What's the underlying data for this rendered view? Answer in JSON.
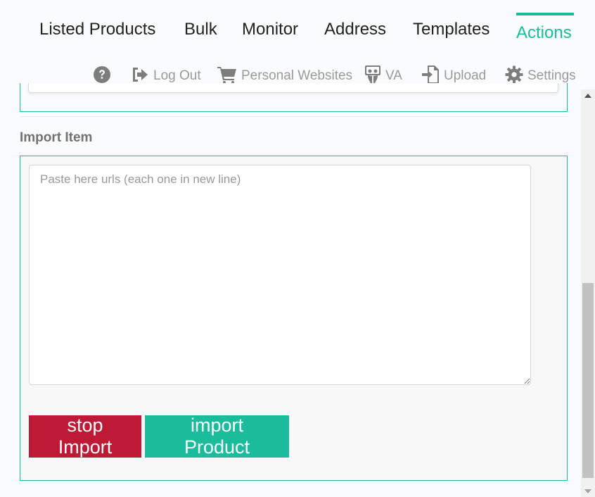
{
  "tabs": [
    {
      "label": "Listed Products"
    },
    {
      "label": "Bulk"
    },
    {
      "label": "Monitor"
    },
    {
      "label": "Address"
    },
    {
      "label": "Templates"
    },
    {
      "label": "Actions",
      "active": true
    }
  ],
  "toolbar": {
    "help_icon": "question-circle-icon",
    "logout": {
      "label": "Log Out",
      "icon": "sign-out-icon"
    },
    "personal_websites": {
      "label": "Personal Websites",
      "icon": "shopping-cart-icon"
    },
    "va": {
      "label": "VA",
      "icon": "slideshare-icon"
    },
    "upload": {
      "label": "Upload",
      "icon": "upload-file-icon"
    },
    "settings": {
      "label": "Settings",
      "icon": "gear-icon"
    }
  },
  "import_item": {
    "title": "Import Item",
    "textarea": {
      "placeholder": "Paste here urls (each one in new line)",
      "value": ""
    },
    "stop_button": "stop Import",
    "import_button": "import Product"
  },
  "colors": {
    "accent": "#1bbc9b",
    "danger": "#be1a35",
    "muted_text": "#9a9a9a"
  }
}
